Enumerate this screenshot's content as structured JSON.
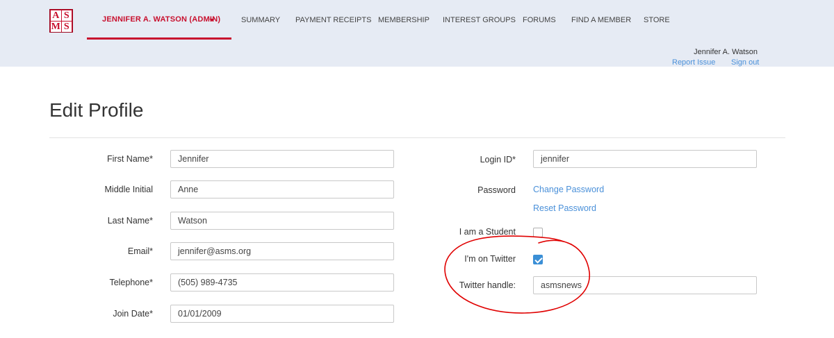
{
  "logo": {
    "letters": [
      "AS",
      "MS"
    ],
    "letters2": [
      "A",
      "S",
      "M",
      "S"
    ]
  },
  "header": {
    "admin_name": "JENNIFER A. WATSON (ADMIN)",
    "nav": [
      "SUMMARY",
      "PAYMENT RECEIPTS",
      "MEMBERSHIP",
      "INTEREST GROUPS",
      "FORUMS",
      "FIND A MEMBER",
      "STORE"
    ],
    "user_name": "Jennifer A. Watson",
    "report_issue": "Report Issue",
    "sign_out": "Sign out"
  },
  "page": {
    "title": "Edit Profile"
  },
  "left_form": {
    "first_name_label": "First Name*",
    "first_name": "Jennifer",
    "middle_initial_label": "Middle Initial",
    "middle_initial": "Anne",
    "last_name_label": "Last Name*",
    "last_name": "Watson",
    "email_label": "Email*",
    "email": "jennifer@asms.org",
    "telephone_label": "Telephone*",
    "telephone": "(505) 989-4735",
    "join_date_label": "Join Date*",
    "join_date": "01/01/2009"
  },
  "right_form": {
    "login_id_label": "Login ID*",
    "login_id": "jennifer",
    "password_label": "Password",
    "change_password": "Change Password",
    "reset_password": "Reset Password",
    "student_label": "I am a Student",
    "student_checked": false,
    "twitter_label": "I'm on Twitter",
    "twitter_checked": true,
    "twitter_handle_label": "Twitter handle:",
    "twitter_handle": "asmsnews"
  },
  "colors": {
    "brand_red": "#c8102e",
    "link_blue": "#4a90d9",
    "header_bg": "#e6ebf4",
    "checkbox_blue": "#3b8fd6",
    "annotation_red": "#e00000"
  }
}
